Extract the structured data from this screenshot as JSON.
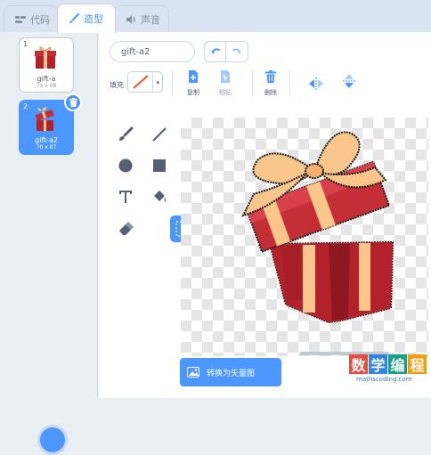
{
  "tabs": [
    {
      "label": "代码",
      "icon": "code-icon"
    },
    {
      "label": "造型",
      "icon": "brush-icon"
    },
    {
      "label": "声音",
      "icon": "speaker-icon"
    }
  ],
  "costumes": [
    {
      "number": "1",
      "name": "gift-a",
      "size": "73 x 68"
    },
    {
      "number": "2",
      "name": "gift-a2",
      "size": "70 x 87"
    }
  ],
  "editor": {
    "costume_name": "gift-a2",
    "fill_label": "填充",
    "copy_label": "复制",
    "paste_label": "粘贴",
    "delete_label": "删除",
    "convert_label": "转换为矢量图"
  },
  "colors": {
    "accent": "#4c97ff",
    "gift_red": "#b3212a",
    "ribbon": "#f8c58a"
  },
  "watermark": {
    "chars": [
      "数",
      "学",
      "编",
      "程"
    ],
    "colors": [
      "#e74c3c",
      "#2e86de",
      "#16a085",
      "#f39c12"
    ],
    "url": "mathscoding.com"
  }
}
